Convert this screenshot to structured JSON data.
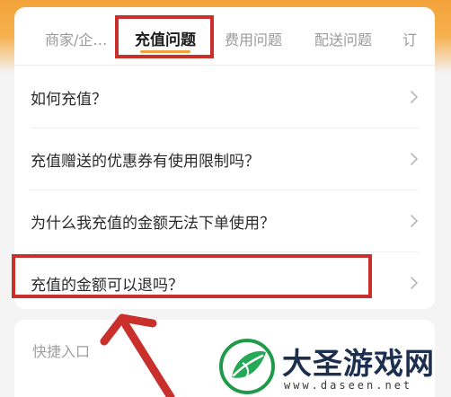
{
  "tabs": [
    {
      "label": "商家/企…",
      "active": false
    },
    {
      "label": "充值问题",
      "active": true
    },
    {
      "label": "费用问题",
      "active": false
    },
    {
      "label": "配送问题",
      "active": false
    },
    {
      "label": "订",
      "active": false
    }
  ],
  "faq": [
    {
      "label": "如何充值？"
    },
    {
      "label": "充值赠送的优惠券有使用限制吗？"
    },
    {
      "label": "为什么我充值的金额无法下单使用？"
    },
    {
      "label": "充值的金额可以退吗？"
    }
  ],
  "quick_entry": {
    "title": "快捷入口"
  },
  "watermark": {
    "name": "大圣游戏网",
    "url": "www.daseen.net"
  },
  "colors": {
    "accent_orange": "#f2a33c",
    "highlight_red": "#c9302c",
    "text_dark": "#2a2a2a",
    "text_muted": "#9a9a9a"
  },
  "icons": {
    "row_chevron": "chevron-right-icon",
    "annotation_arrow": "arrow-up-icon",
    "watermark_logo": "leaf-logo-icon"
  }
}
